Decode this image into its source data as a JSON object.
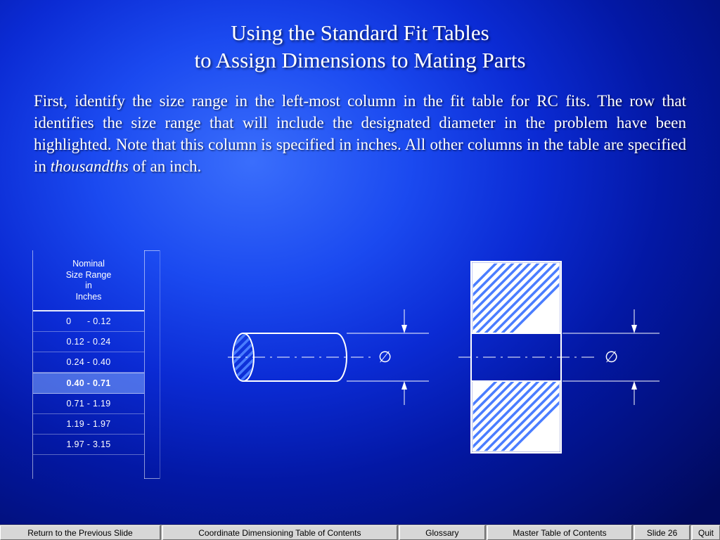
{
  "title": {
    "line1": "Using the Standard Fit Tables",
    "line2": "to Assign Dimensions to Mating Parts"
  },
  "body": {
    "p1a": "First, identify the size range in the left-most column in the fit table for RC fits. The row that identifies the size range that will include the designated diameter in the problem have been highlighted. Note that this column is specified in inches. All other columns in the table are specified in ",
    "p1_em": "thousandths",
    "p1b": " of an inch."
  },
  "size_table": {
    "header_l1": "Nominal",
    "header_l2": "Size Range",
    "header_l3": "in",
    "header_l4": "Inches",
    "rows": [
      "0      - 0.12",
      "0.12 - 0.24",
      "0.24 - 0.40",
      "0.40 - 0.71",
      "0.71 - 1.19",
      "1.19 - 1.97",
      "1.97 - 3.15"
    ],
    "highlight_index": 3
  },
  "diagram": {
    "diameter_symbol": "∅"
  },
  "navbar": {
    "prev": "Return to the Previous Slide",
    "coord": "Coordinate Dimensioning Table of Contents",
    "glossary": "Glossary",
    "master": "Master Table of Contents",
    "slide": "Slide 26",
    "quit": "Quit"
  }
}
